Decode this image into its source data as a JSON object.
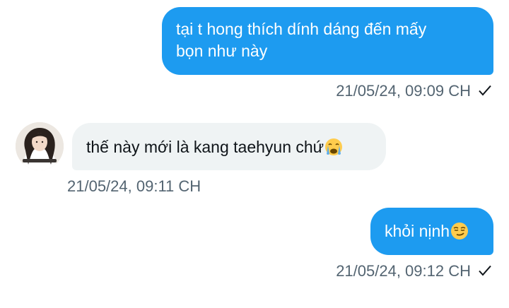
{
  "messages": [
    {
      "direction": "out",
      "text_line1": "tại t hong thích dính dáng đến mấy",
      "text_line2": "bọn như này",
      "timestamp": "21/05/24, 09:09 CH",
      "status_icon": "checkmark-icon"
    },
    {
      "direction": "in",
      "text": "thế này mới là kang taehyun chứ",
      "emoji": "crying-face-emoji",
      "timestamp": "21/05/24, 09:11 CH",
      "avatar": "sender-avatar"
    },
    {
      "direction": "out",
      "text": "khỏi nịnh",
      "emoji": "smirking-face-emoji",
      "timestamp": "21/05/24, 09:12 CH",
      "status_icon": "checkmark-icon"
    }
  ],
  "colors": {
    "outgoing_bubble": "#1d9bf0",
    "incoming_bubble": "#eff3f4",
    "timestamp_text": "#536471",
    "message_text": "#0f1419"
  }
}
